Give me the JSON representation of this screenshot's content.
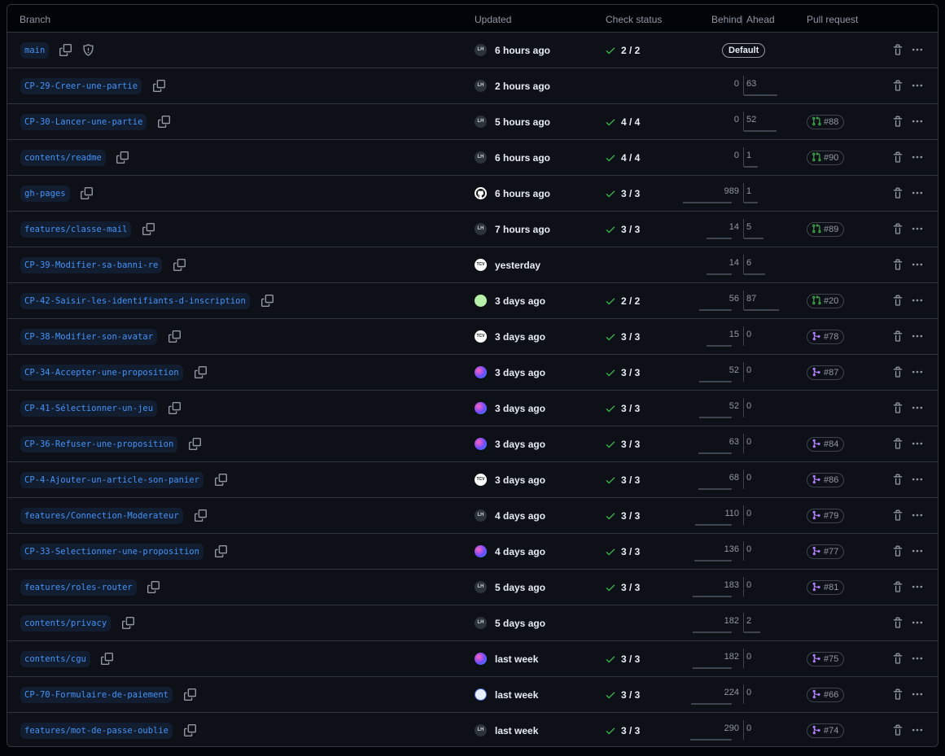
{
  "header": {
    "branch": "Branch",
    "updated": "Updated",
    "check_status": "Check status",
    "behind": "Behind",
    "ahead": "Ahead",
    "pull_request": "Pull request"
  },
  "colors": {
    "branch_text": "#4493f8",
    "check_green": "#3fb950",
    "pr_open": "#3fb950",
    "pr_merged": "#ab7df8"
  },
  "rows": [
    {
      "name": "main",
      "avatar": "LH",
      "updated": "6 hours ago",
      "check": "2 / 2",
      "behind": "",
      "ahead": "",
      "default": "Default",
      "pr": null,
      "pr_state": null,
      "protected": true
    },
    {
      "name": "CP-29-Creer-une-partie",
      "avatar": "LH",
      "updated": "2 hours ago",
      "check": "",
      "behind": "0",
      "ahead": "63",
      "pr": null,
      "pr_state": null
    },
    {
      "name": "CP-30-Lancer-une-partie",
      "avatar": "LH",
      "updated": "5 hours ago",
      "check": "4 / 4",
      "behind": "0",
      "ahead": "52",
      "pr": "#88",
      "pr_state": "open"
    },
    {
      "name": "contents/readme",
      "avatar": "LH",
      "updated": "6 hours ago",
      "check": "4 / 4",
      "behind": "0",
      "ahead": "1",
      "pr": "#90",
      "pr_state": "open"
    },
    {
      "name": "gh-pages",
      "avatar": "github",
      "updated": "6 hours ago",
      "check": "3 / 3",
      "behind": "989",
      "ahead": "1",
      "pr": null,
      "pr_state": null
    },
    {
      "name": "features/classe-mail",
      "avatar": "LH",
      "updated": "7 hours ago",
      "check": "3 / 3",
      "behind": "14",
      "ahead": "5",
      "pr": "#89",
      "pr_state": "open"
    },
    {
      "name": "CP-39-Modifier-sa-banni-re",
      "avatar": "TCV",
      "updated": "yesterday",
      "check": "",
      "behind": "14",
      "ahead": "6",
      "pr": null,
      "pr_state": null
    },
    {
      "name": "CP-42-Saisir-les-identifiants-d-inscription",
      "avatar": "grid",
      "updated": "3 days ago",
      "check": "2 / 2",
      "behind": "56",
      "ahead": "87",
      "pr": "#20",
      "pr_state": "open"
    },
    {
      "name": "CP-38-Modifier-son-avatar",
      "avatar": "TCV",
      "updated": "3 days ago",
      "check": "3 / 3",
      "behind": "15",
      "ahead": "0",
      "pr": "#78",
      "pr_state": "merged"
    },
    {
      "name": "CP-34-Accepter-une-proposition",
      "avatar": "grad",
      "updated": "3 days ago",
      "check": "3 / 3",
      "behind": "52",
      "ahead": "0",
      "pr": "#87",
      "pr_state": "merged"
    },
    {
      "name": "CP-41-Sélectionner-un-jeu",
      "avatar": "grad",
      "updated": "3 days ago",
      "check": "3 / 3",
      "behind": "52",
      "ahead": "0",
      "pr": null,
      "pr_state": null
    },
    {
      "name": "CP-36-Refuser-une-proposition",
      "avatar": "grad",
      "updated": "3 days ago",
      "check": "3 / 3",
      "behind": "63",
      "ahead": "0",
      "pr": "#84",
      "pr_state": "merged"
    },
    {
      "name": "CP-4-Ajouter-un-article-son-panier",
      "avatar": "TCV",
      "updated": "3 days ago",
      "check": "3 / 3",
      "behind": "68",
      "ahead": "0",
      "pr": "#86",
      "pr_state": "merged"
    },
    {
      "name": "features/Connection-Moderateur",
      "avatar": "LH",
      "updated": "4 days ago",
      "check": "3 / 3",
      "behind": "110",
      "ahead": "0",
      "pr": "#79",
      "pr_state": "merged"
    },
    {
      "name": "CP-33-Selectionner-une-proposition",
      "avatar": "grad",
      "updated": "4 days ago",
      "check": "3 / 3",
      "behind": "136",
      "ahead": "0",
      "pr": "#77",
      "pr_state": "merged"
    },
    {
      "name": "features/roles-router",
      "avatar": "LH",
      "updated": "5 days ago",
      "check": "3 / 3",
      "behind": "183",
      "ahead": "0",
      "pr": "#81",
      "pr_state": "merged"
    },
    {
      "name": "contents/privacy",
      "avatar": "LH",
      "updated": "5 days ago",
      "check": "",
      "behind": "182",
      "ahead": "2",
      "pr": null,
      "pr_state": null
    },
    {
      "name": "contents/cgu",
      "avatar": "grad",
      "updated": "last week",
      "check": "3 / 3",
      "behind": "182",
      "ahead": "0",
      "pr": "#75",
      "pr_state": "merged"
    },
    {
      "name": "CP-70-Formulaire-de-paiement",
      "avatar": "robot",
      "updated": "last week",
      "check": "3 / 3",
      "behind": "224",
      "ahead": "0",
      "pr": "#66",
      "pr_state": "merged"
    },
    {
      "name": "features/mot-de-passe-oublie",
      "avatar": "LH",
      "updated": "last week",
      "check": "3 / 3",
      "behind": "290",
      "ahead": "0",
      "pr": "#74",
      "pr_state": "merged"
    }
  ]
}
